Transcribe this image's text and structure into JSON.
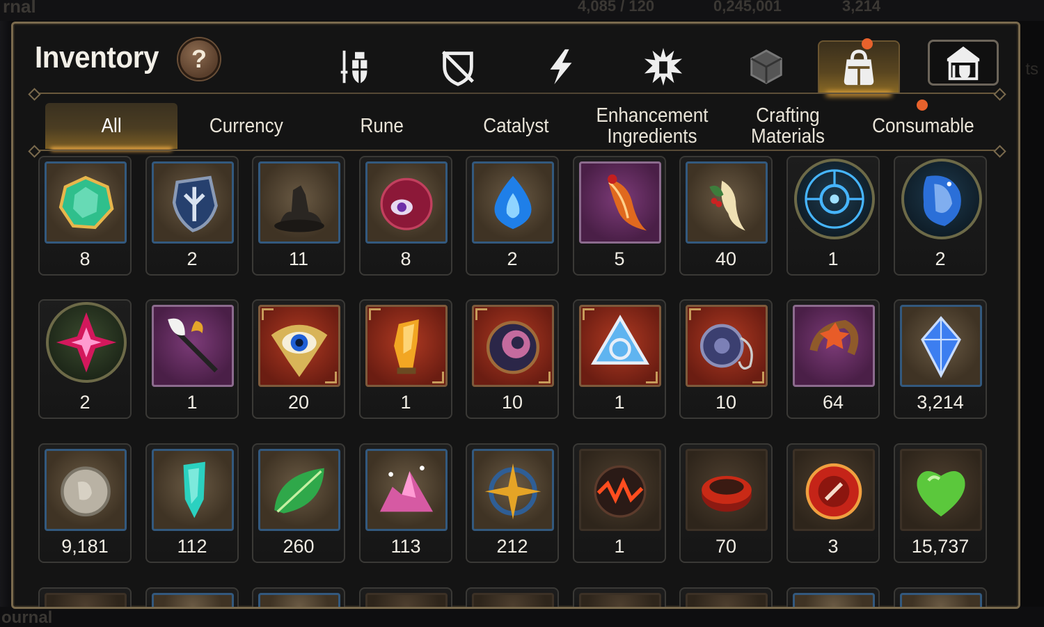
{
  "background": {
    "top_left_text": "rnal",
    "top_center_text": "4,085 / 120",
    "top_center_text_2": "0,245,001",
    "top_center_text_3": "3,214",
    "bottom_left_text": "ournal",
    "right_text": "ts"
  },
  "inventory": {
    "title": "Inventory",
    "help_label": "?",
    "category_tabs": [
      {
        "icon": "sword-shield-icon",
        "active": false
      },
      {
        "icon": "broken-shield-icon",
        "active": false
      },
      {
        "icon": "lightning-icon",
        "active": false
      },
      {
        "icon": "spiky-emblem-icon",
        "active": false
      },
      {
        "icon": "cube-icon",
        "active": false
      },
      {
        "icon": "bag-icon",
        "active": true,
        "notification": true
      },
      {
        "icon": "guild-house-icon",
        "active": false
      }
    ],
    "sub_tabs": [
      {
        "label": "All",
        "active": true
      },
      {
        "label": "Currency",
        "active": false
      },
      {
        "label": "Rune",
        "active": false
      },
      {
        "label": "Catalyst",
        "active": false
      },
      {
        "label": "Enhancement Ingredients",
        "active": false
      },
      {
        "label": "Crafting Materials",
        "active": false
      },
      {
        "label": "Consumable",
        "active": false,
        "notification": true
      }
    ],
    "items": [
      {
        "icon": "green-gem-icon",
        "qty": "8",
        "frame": "blue"
      },
      {
        "icon": "blue-shield-crest-icon",
        "qty": "2",
        "frame": "blue"
      },
      {
        "icon": "dark-tar-icon",
        "qty": "11",
        "frame": "blue"
      },
      {
        "icon": "crimson-eye-orb-icon",
        "qty": "8",
        "frame": "blue"
      },
      {
        "icon": "blue-flame-icon",
        "qty": "2",
        "frame": "blue"
      },
      {
        "icon": "phoenix-feather-icon",
        "qty": "5",
        "frame": "purple"
      },
      {
        "icon": "ginseng-root-icon",
        "qty": "40",
        "frame": "blue"
      },
      {
        "icon": "blue-rune-circle-icon",
        "qty": "1",
        "frame": "round"
      },
      {
        "icon": "starry-crystal-icon",
        "qty": "2",
        "frame": "round"
      },
      {
        "icon": "pink-star-crystal-icon",
        "qty": "2",
        "frame": "round-pink"
      },
      {
        "icon": "feather-wand-icon",
        "qty": "1",
        "frame": "purple"
      },
      {
        "icon": "golden-eye-icon",
        "qty": "20",
        "frame": "red"
      },
      {
        "icon": "amber-shard-icon",
        "qty": "1",
        "frame": "red"
      },
      {
        "icon": "runic-disc-icon",
        "qty": "10",
        "frame": "red"
      },
      {
        "icon": "triquetra-crystal-icon",
        "qty": "1",
        "frame": "red"
      },
      {
        "icon": "rune-disc-pendant-icon",
        "qty": "10",
        "frame": "red"
      },
      {
        "icon": "flower-ring-icon",
        "qty": "64",
        "frame": "purple"
      },
      {
        "icon": "blue-diamond-icon",
        "qty": "3,214",
        "frame": "blue"
      },
      {
        "icon": "silver-coin-icon",
        "qty": "9,181",
        "frame": "blue"
      },
      {
        "icon": "teal-crystal-icon",
        "qty": "112",
        "frame": "blue"
      },
      {
        "icon": "green-leaf-icon",
        "qty": "260",
        "frame": "blue"
      },
      {
        "icon": "pink-crystal-pile-icon",
        "qty": "113",
        "frame": "blue"
      },
      {
        "icon": "star-compass-pendant-icon",
        "qty": "212",
        "frame": "blue"
      },
      {
        "icon": "red-wave-orb-icon",
        "qty": "1",
        "frame": "brown"
      },
      {
        "icon": "red-bracelet-icon",
        "qty": "70",
        "frame": "brown"
      },
      {
        "icon": "red-seal-badge-icon",
        "qty": "3",
        "frame": "brown"
      },
      {
        "icon": "green-heart-icon",
        "qty": "15,737",
        "frame": "brown"
      }
    ],
    "partial_row_frames": [
      "brown",
      "blue",
      "blue",
      "brown",
      "brown",
      "brown",
      "brown",
      "blue",
      "blue"
    ]
  },
  "colors": {
    "accent_gold": "#ffb640",
    "notification": "#e8622c",
    "panel_border": "#7a6a4d"
  }
}
